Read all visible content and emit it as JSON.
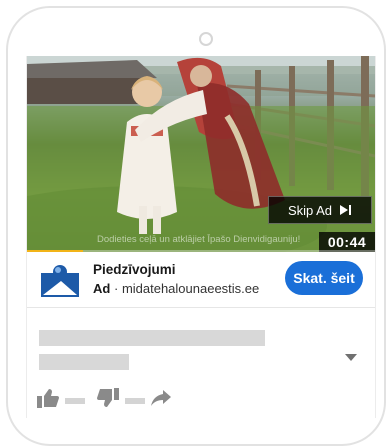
{
  "video": {
    "caption": "Dodieties ceļā un atklājiet Īpašo Dienvidigauniju!",
    "skip_label": "Skip Ad",
    "timer": "00:44",
    "progress_fraction": 0.16
  },
  "ad": {
    "title": "Piedzīvojumi",
    "badge": "Ad",
    "separator": "·",
    "url": "midatehalounaeestis.ee",
    "cta_label": "Skat. šeit"
  },
  "icons": {
    "skip": "skip-next-icon",
    "logo": "advertiser-logo",
    "like": "thumbs-up-icon",
    "dislike": "thumbs-down-icon",
    "share": "share-arrow-icon",
    "expand": "chevron-down-icon"
  },
  "colors": {
    "progress": "#f2b418",
    "cta": "#1a6fd8",
    "placeholder": "#d8d8d8"
  }
}
